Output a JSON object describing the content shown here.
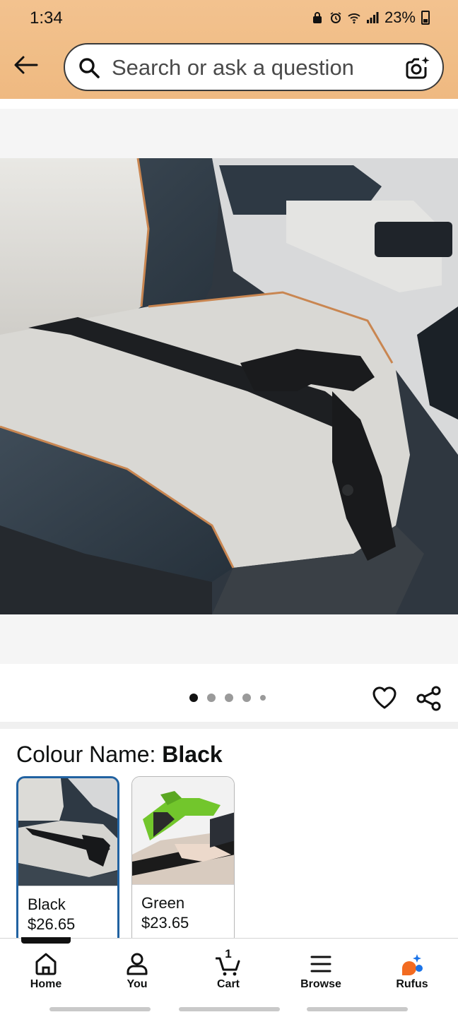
{
  "status_bar": {
    "time": "1:34",
    "battery": "23%"
  },
  "header": {
    "search_placeholder": "Search or ask a question"
  },
  "gallery": {
    "image_count": 5,
    "active_index": 0
  },
  "variations": {
    "label_prefix": "Colour Name: ",
    "selected": "Black",
    "options": [
      {
        "name": "Black",
        "price": "$26.65",
        "selected": true
      },
      {
        "name": "Green",
        "price": "$23.65",
        "selected": false
      }
    ]
  },
  "bottom_nav": {
    "items": [
      {
        "label": "Home",
        "icon": "home-icon"
      },
      {
        "label": "You",
        "icon": "user-icon"
      },
      {
        "label": "Cart",
        "icon": "cart-icon",
        "count": "1"
      },
      {
        "label": "Browse",
        "icon": "menu-icon"
      },
      {
        "label": "Rufus",
        "icon": "rufus-icon"
      }
    ]
  },
  "colors": {
    "header_gradient": "#f0bd86",
    "selected_border": "#2162a1",
    "rufus_orange": "#f26b21",
    "rufus_blue": "#1a73e8"
  }
}
